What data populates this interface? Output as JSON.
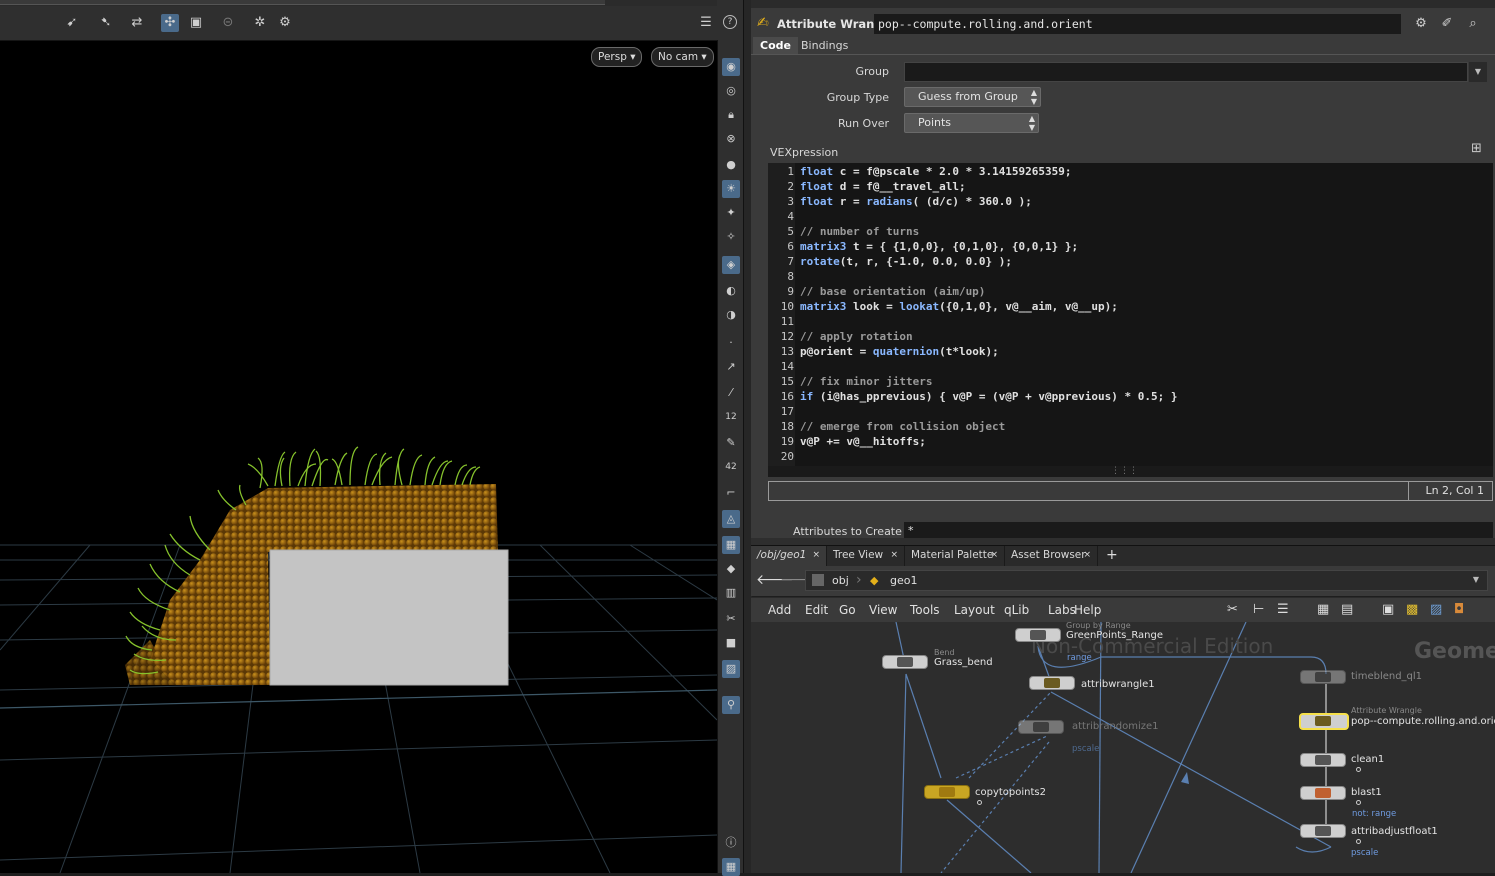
{
  "viewport": {
    "camera_mode": "Persp ▾",
    "camera": "No cam ▾"
  },
  "param_pane": {
    "node_type": "Attribute Wrangle",
    "node_name": "pop--compute.rolling.and.orient",
    "tabs": [
      "Code",
      "Bindings"
    ],
    "group_label": "Group",
    "group_value": "",
    "group_type_label": "Group Type",
    "group_type_value": "Guess from Group",
    "run_over_label": "Run Over",
    "run_over_value": "Points",
    "vex_label": "VEXpression",
    "code_lines": [
      "float c = f@pscale * 2.0 * 3.14159265359;",
      "float d = f@__travel_all;",
      "float r = radians( (d/c) * 360.0 );",
      "",
      "// number of turns",
      "matrix3 t = { {1,0,0}, {0,1,0}, {0,0,1} };",
      "rotate(t, r, {-1.0, 0.0, 0.0} );",
      "",
      "// base orientation (aim/up)",
      "matrix3 look = lookat({0,1,0}, v@__aim, v@__up);",
      "",
      "// apply rotation",
      "p@orient = quaternion(t*look);",
      "",
      "// fix minor jitters",
      "if (i@has_pprevious) { v@P = (v@P + v@pprevious) * 0.5; }",
      "",
      "// emerge from collision object",
      "v@P += v@__hitoffs;",
      ""
    ],
    "line_numbers": [
      "1",
      "2",
      "3",
      "4",
      "5",
      "6",
      "7",
      "8",
      "9",
      "10",
      "11",
      "12",
      "13",
      "14",
      "15",
      "16",
      "17",
      "18",
      "19",
      "20"
    ],
    "cursor_pos": "Ln 2, Col 1",
    "attributes_label": "Attributes to Create",
    "attributes_value": "*"
  },
  "lower_tabs": [
    {
      "label": "/obj/geo1"
    },
    {
      "label": "Tree View"
    },
    {
      "label": "Material Palette"
    },
    {
      "label": "Asset Browser"
    }
  ],
  "path": {
    "obj": "obj",
    "geo": "geo1"
  },
  "menu": [
    "Add",
    "Edit",
    "Go",
    "View",
    "Tools",
    "Layout",
    "qLib",
    "Labs",
    "Help"
  ],
  "network": {
    "watermark": "Non-Commercial Edition",
    "context_label": "Geome",
    "nodes": {
      "grass_bend": {
        "type": "Bend",
        "name": "Grass_bend"
      },
      "greenpoints": {
        "type": "Group by Range",
        "name": "GreenPoints_Range",
        "sub": "range"
      },
      "attribwrangle1": {
        "name": "attribwrangle1"
      },
      "attribrandomize1": {
        "name": "attribrandomize1",
        "sub": "pscale"
      },
      "copytopoints2": {
        "name": "copytopoints2"
      },
      "timeblend": {
        "name": "timeblend_ql1"
      },
      "pop_orient": {
        "type": "Attribute Wrangle",
        "name": "pop--compute.rolling.and.orient"
      },
      "clean1": {
        "name": "clean1"
      },
      "blast1": {
        "name": "blast1",
        "sub": "not: range"
      },
      "attribadjust": {
        "name": "attribadjustfloat1",
        "sub": "pscale"
      }
    }
  },
  "colors": {
    "accent": "#4a6a8a",
    "node_yellow": "#c9a623",
    "selected_outline": "#f6e04a",
    "keyword_blue": "#8ab8ff"
  }
}
